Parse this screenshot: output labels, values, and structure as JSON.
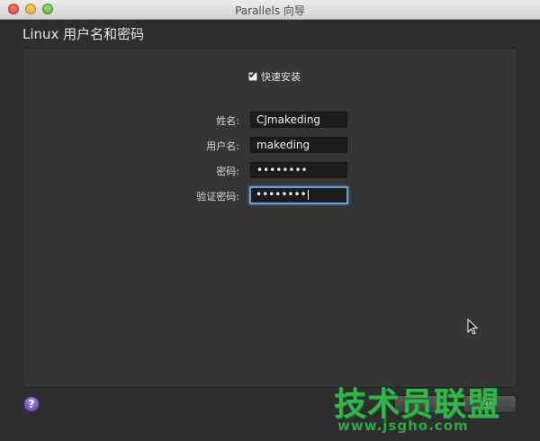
{
  "window": {
    "title": "Parallels 向导"
  },
  "header": {
    "title": "Linux 用户名和密码"
  },
  "quick_install": {
    "label": "快速安装",
    "checked": true
  },
  "form": {
    "fields": [
      {
        "label": "姓名:",
        "value": "CJmakeding"
      },
      {
        "label": "用户名:",
        "value": "makeding"
      },
      {
        "label": "密码:",
        "value": "••••••••"
      },
      {
        "label": "验证密码:",
        "value": "••••••••"
      }
    ]
  },
  "buttons": {
    "help": "?",
    "prev": "",
    "next": "续"
  },
  "watermark": {
    "text": "技术员联盟",
    "url": "www.jsgho.com"
  },
  "colors": {
    "accent_focus": "#6b9fd4",
    "watermark_green": "#33b54a",
    "panel_bg": "#353535"
  }
}
